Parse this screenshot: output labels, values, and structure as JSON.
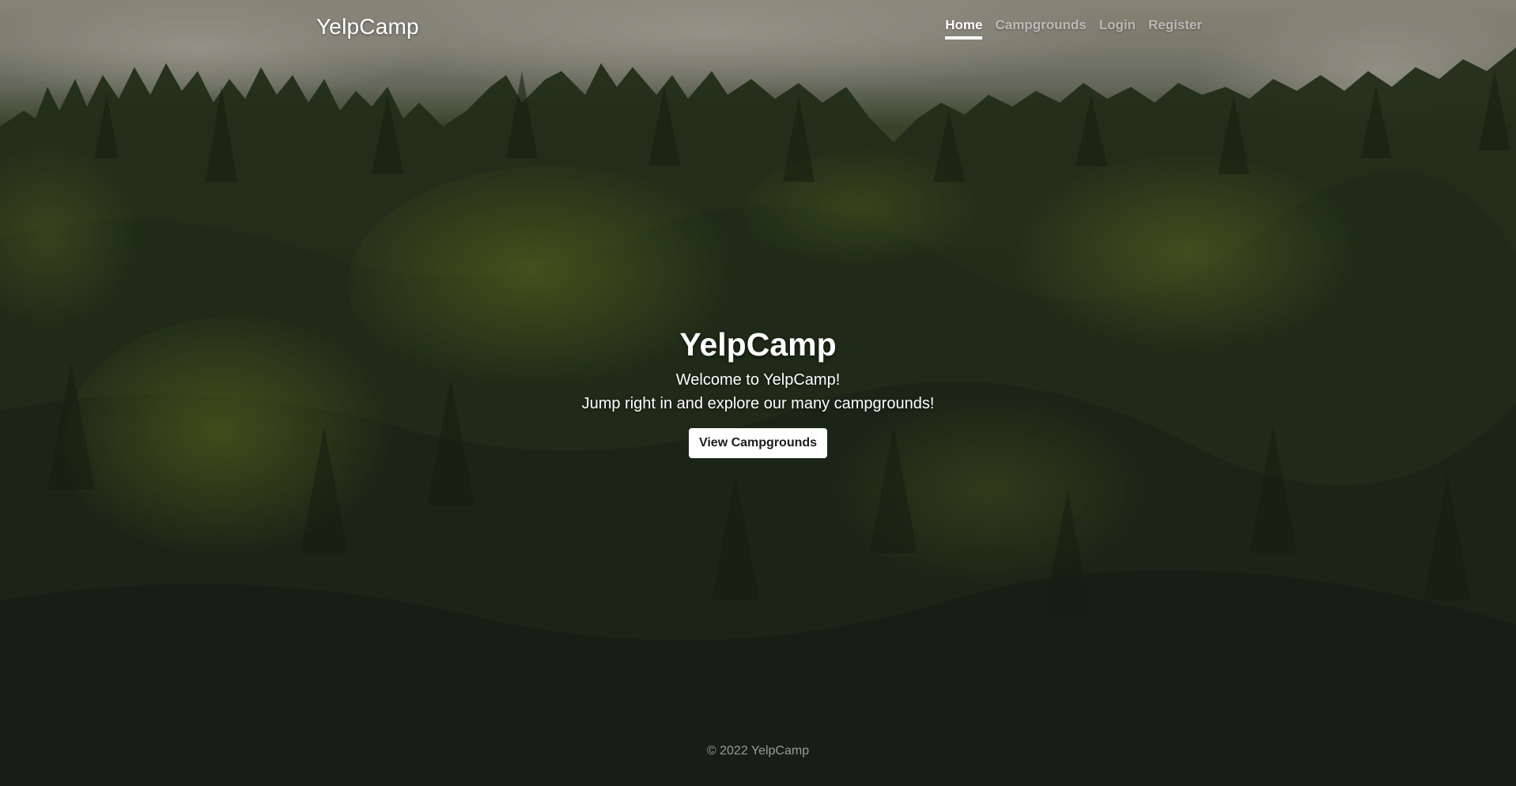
{
  "header": {
    "brand": "YelpCamp",
    "nav": [
      {
        "label": "Home",
        "active": true
      },
      {
        "label": "Campgrounds",
        "active": false
      },
      {
        "label": "Login",
        "active": false
      },
      {
        "label": "Register",
        "active": false
      }
    ]
  },
  "hero": {
    "title": "YelpCamp",
    "line1": "Welcome to YelpCamp!",
    "line2": "Jump right in and explore our many campgrounds!",
    "cta_label": "View Campgrounds"
  },
  "footer": {
    "text": "© 2022 YelpCamp"
  },
  "colors": {
    "nav_active": "#ffffff",
    "nav_inactive": "rgba(255,255,255,0.55)",
    "button_bg": "#ffffff",
    "button_text": "#1b1b1b"
  }
}
